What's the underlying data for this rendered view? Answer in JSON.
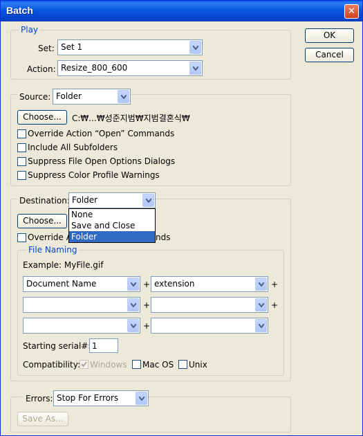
{
  "window": {
    "title": "Batch",
    "close_glyph": "✕"
  },
  "buttons": {
    "ok": "OK",
    "cancel": "Cancel"
  },
  "play": {
    "legend": "Play",
    "set_label": "Set:",
    "set_value": "Set 1",
    "action_label": "Action:",
    "action_value": "Resize_800_600"
  },
  "source": {
    "label": "Source:",
    "value": "Folder",
    "choose_button": "Choose...",
    "path": "C:₩...₩성준지범₩지범결혼식₩",
    "options": [
      {
        "label": "Override Action “Open” Commands",
        "checked": false
      },
      {
        "label": "Include All Subfolders",
        "checked": false
      },
      {
        "label": "Suppress File Open Options Dialogs",
        "checked": false
      },
      {
        "label": "Suppress Color Profile Warnings",
        "checked": false
      }
    ]
  },
  "destination": {
    "label": "Destination:",
    "value": "Folder",
    "choose_button": "Choose...",
    "override_label_start": "Override Ac",
    "override_label_end": "nds",
    "dropdown_options": [
      "None",
      "Save and Close",
      "Folder"
    ],
    "dropdown_selected": "Folder",
    "file_naming": {
      "legend": "File Naming",
      "example": "Example: MyFile.gif",
      "rows": [
        {
          "left": "Document Name",
          "right": "extension"
        },
        {
          "left": "",
          "right": ""
        },
        {
          "left": "",
          "right": ""
        }
      ],
      "plus": "+",
      "serial_label": "Starting serial#:",
      "serial_value": "1",
      "compat_label": "Compatibility:",
      "compat": [
        {
          "label": "Windows",
          "checked": true,
          "disabled": true
        },
        {
          "label": "Mac OS",
          "checked": false,
          "disabled": false
        },
        {
          "label": "Unix",
          "checked": false,
          "disabled": false
        }
      ]
    }
  },
  "errors": {
    "label": "Errors:",
    "value": "Stop For Errors",
    "save_as_button": "Save As..."
  }
}
